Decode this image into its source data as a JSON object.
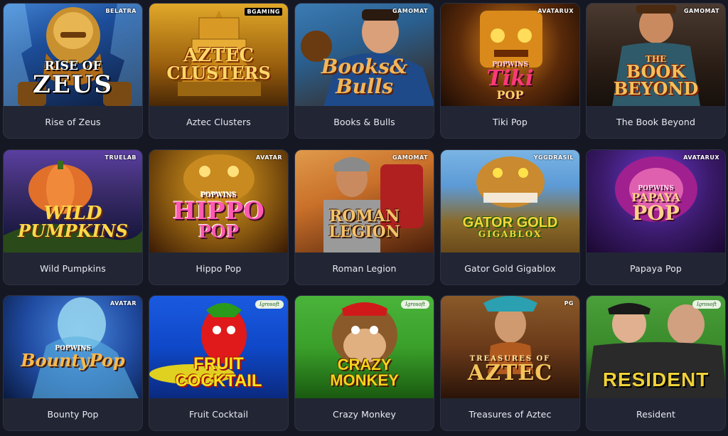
{
  "games": [
    {
      "title": "Rise of Zeus",
      "provider": "BELATRA",
      "logo": [
        "RISE OF",
        "ZEUS"
      ],
      "bg": [
        "#1d4e9a",
        "#0d1c3c"
      ]
    },
    {
      "title": "Aztec Clusters",
      "provider": "BGAMING",
      "logo": [
        "AZTEC",
        "CLUSTERS"
      ],
      "bg": [
        "#c98a18",
        "#5a3408"
      ]
    },
    {
      "title": "Books & Bulls",
      "provider": "GAMOMAT",
      "logo": [
        "Books&",
        "Bulls"
      ],
      "bg": [
        "#2a5f8f",
        "#3a2210"
      ]
    },
    {
      "title": "Tiki Pop",
      "provider": "AVATARUX",
      "logo": [
        "POPWINS",
        "Tiki",
        "POP"
      ],
      "bg": [
        "#5a2a0a",
        "#1c0c04"
      ]
    },
    {
      "title": "The Book Beyond",
      "provider": "GAMOMAT",
      "logo": [
        "THE",
        "BOOK",
        "BEYOND"
      ],
      "bg": [
        "#3a2a20",
        "#17100c"
      ]
    },
    {
      "title": "Wild Pumpkins",
      "provider": "TRUELAB",
      "logo": [
        "WILD",
        "PUMPKINS"
      ],
      "bg": [
        "#3a2c6a",
        "#0d1030"
      ]
    },
    {
      "title": "Hippo Pop",
      "provider": "AVATAR",
      "logo": [
        "POPWINS",
        "HIPPO",
        "POP"
      ],
      "bg": [
        "#8a5a10",
        "#3a1a04"
      ]
    },
    {
      "title": "Roman Legion",
      "provider": "GAMOMAT",
      "logo": [
        "ROMAN",
        "LEGION"
      ],
      "bg": [
        "#c9702a",
        "#4a1e0a"
      ]
    },
    {
      "title": "Gator Gold Gigablox",
      "provider": "YGGDRASIL",
      "logo": [
        "GATOR GOLD",
        "GIGABLOX"
      ],
      "bg": [
        "#5c9ad6",
        "#6a4a1a"
      ]
    },
    {
      "title": "Papaya Pop",
      "provider": "AVATARUX",
      "logo": [
        "POPWINS",
        "PAPAYA",
        "POP"
      ],
      "bg": [
        "#3a1a6a",
        "#1a0830"
      ]
    },
    {
      "title": "Bounty Pop",
      "provider": "AVATAR",
      "logo": [
        "POPWINS",
        "BountyPop"
      ],
      "bg": [
        "#1f4aa0",
        "#0a1a40"
      ]
    },
    {
      "title": "Fruit Cocktail",
      "provider": "Igrosoft",
      "logo": [
        "FRUIT",
        "COCKTAIL"
      ],
      "bg": [
        "#0f48c8",
        "#0a2a80"
      ]
    },
    {
      "title": "Crazy Monkey",
      "provider": "Igrosoft",
      "logo": [
        "CRAZY",
        "MONKEY"
      ],
      "bg": [
        "#3aa02a",
        "#1a5a10"
      ]
    },
    {
      "title": "Treasures of Aztec",
      "provider": "PG",
      "logo": [
        "TREASURES OF",
        "AZTEC"
      ],
      "bg": [
        "#6a3a1a",
        "#2a1408"
      ]
    },
    {
      "title": "Resident",
      "provider": "Igrosoft",
      "logo": [
        "RESIDENT"
      ],
      "bg": [
        "#3a8a2a",
        "#1c3a14"
      ]
    }
  ]
}
